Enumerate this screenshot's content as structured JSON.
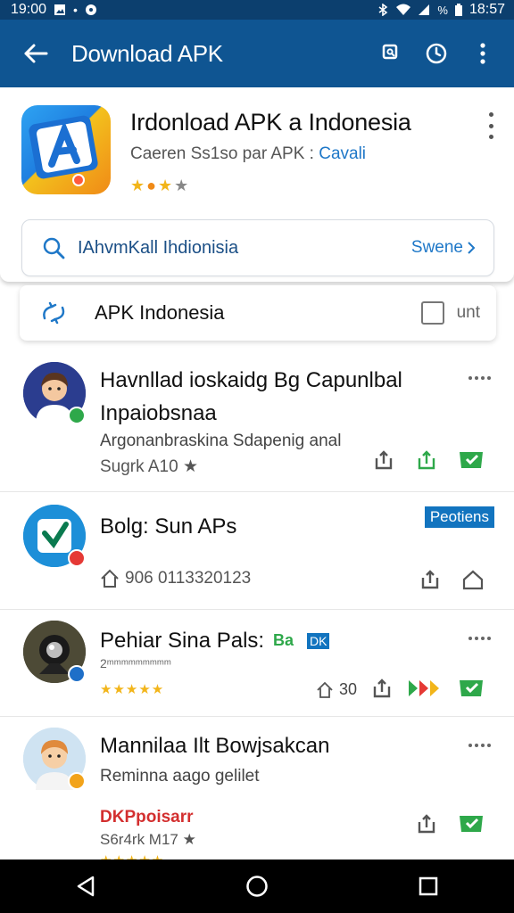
{
  "status_bar": {
    "time_left": "19:00",
    "battery_text": "%",
    "time_right": "18:57",
    "icons": [
      "gallery-icon",
      "notification-icon",
      "bluetooth-icon",
      "wifi-icon",
      "signal-icon",
      "battery-icon"
    ]
  },
  "app_bar": {
    "title": "Download APK",
    "icons": [
      "back-arrow-icon",
      "bookmark-icon",
      "history-icon",
      "overflow-menu-icon"
    ]
  },
  "header": {
    "title": "Irdonload APK a Indonesia",
    "subtitle": "Caeren Ss1so par APK :",
    "subtitle_link": "Cavali",
    "stars": [
      "★",
      "●",
      "★",
      "★"
    ],
    "search": {
      "text": "IAhvmKall Ihdionisia",
      "action_label": "Swene"
    }
  },
  "filter": {
    "label": "APK Indonesia",
    "unit_label": "unt"
  },
  "items": [
    {
      "title_line1": "Havnllad ioskaidg Bg Capunlbal",
      "title_line2": "Inpaiobsnaa",
      "desc": "Argonanbraskina Sdapenig anal",
      "meta": "Sugrk A10 ★"
    },
    {
      "title_line1": "Bolg: Sun APs",
      "tag": "Peotiens",
      "meta": "906 0113320123"
    },
    {
      "title_line1": "Pehiar Sina Pals:",
      "inline_badge_a": "Ba",
      "inline_badge_b": "DK",
      "desc": "2ᵐᵐᵐᵐᵐᵐᵐᵐᵐ",
      "stars": "★★★★★",
      "count": "30"
    },
    {
      "title_line1": "Mannilaa Ilt Bowjsakcan",
      "desc": "Reminna aago gelilet",
      "highlight": "DKPpoisarr",
      "meta": "S6r4rk M17 ★",
      "stars": "★★★★★"
    }
  ],
  "colors": {
    "status_bar": "#0c3f6e",
    "app_bar": "#0f5592",
    "accent_blue": "#1f78c8",
    "action_green": "#2ea84a",
    "star_gold": "#f2b51a"
  }
}
